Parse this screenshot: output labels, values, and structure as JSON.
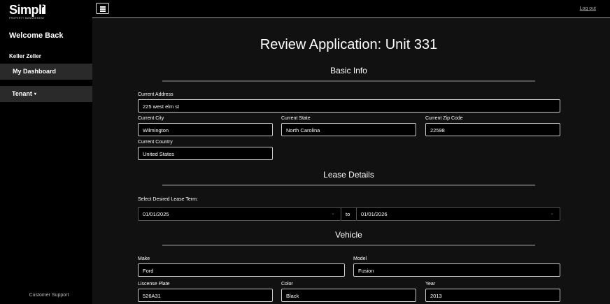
{
  "brand": {
    "name": "Simpli",
    "tagline": "PROPERTY MANAGEMENT"
  },
  "sidebar": {
    "welcome": "Welcome Back",
    "username": "Keller Zeller",
    "items": [
      {
        "label": "My Dashboard"
      },
      {
        "label": "Tenant",
        "caret": "▾"
      }
    ],
    "support": "Customer Support"
  },
  "topbar": {
    "logout": "Log out"
  },
  "page": {
    "title": "Review Application: Unit 331"
  },
  "basic_info": {
    "title": "Basic Info",
    "address_label": "Current Address",
    "address": "225 west elm st",
    "city_label": "Current City",
    "city": "Wilmington",
    "state_label": "Current State",
    "state": "North Carolina",
    "zip_label": "Current Zip Code",
    "zip": "22598",
    "country_label": "Current Country",
    "country": "United States"
  },
  "lease": {
    "title": "Lease Details",
    "term_label": "Select Desired Lease Term:",
    "start": "01/01/2025",
    "to_label": "to",
    "end": "01/01/2026"
  },
  "vehicle": {
    "title": "Vehicle",
    "make_label": "Make",
    "make": "Ford",
    "model_label": "Model",
    "model": "Fusion",
    "plate_label": "Liscense Plate",
    "plate": "526A31",
    "color_label": "Color",
    "color": "Black",
    "year_label": "Year",
    "year": "2013"
  }
}
